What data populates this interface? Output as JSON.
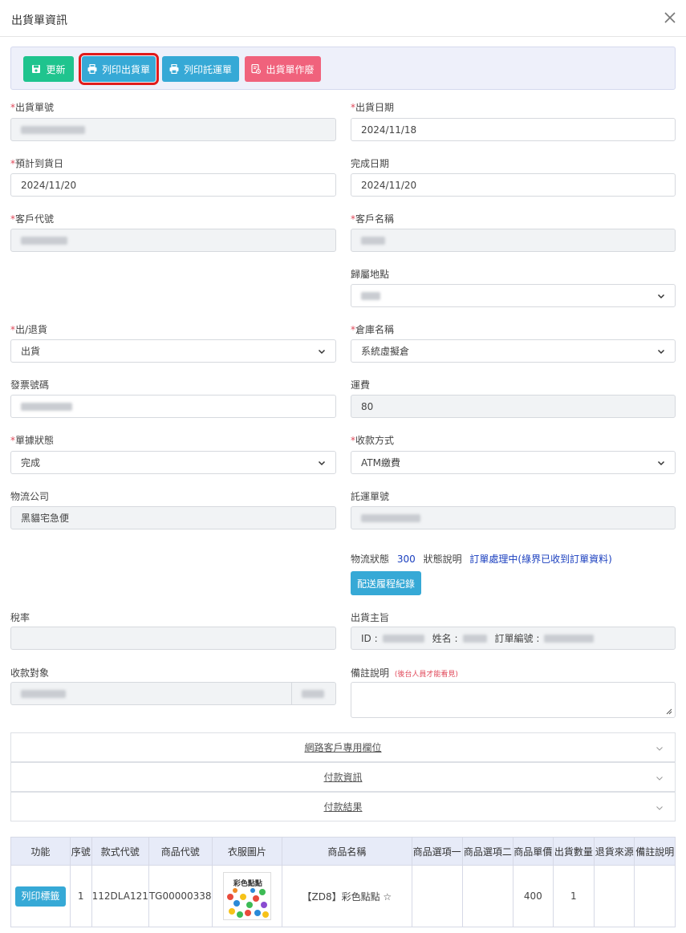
{
  "modal": {
    "title": "出貨單資訊"
  },
  "toolbar": {
    "update": "更新",
    "print_shipment": "列印出貨單",
    "print_consignment": "列印託運單",
    "void_shipment": "出貨單作廢"
  },
  "form": {
    "shipment_no": {
      "label": "出貨單號",
      "required": "*"
    },
    "shipment_date": {
      "label": "出貨日期",
      "required": "*",
      "value": "2024/11/18"
    },
    "expected_arrival": {
      "label": "預計到貨日",
      "required": "*",
      "value": "2024/11/20"
    },
    "completed_date": {
      "label": "完成日期",
      "value": "2024/11/20"
    },
    "customer_code": {
      "label": "客戶代號",
      "required": "*"
    },
    "customer_name": {
      "label": "客戶名稱",
      "required": "*"
    },
    "location": {
      "label": "歸屬地點"
    },
    "ship_return": {
      "label": "出/退貨",
      "required": "*",
      "value": "出貨"
    },
    "warehouse": {
      "label": "倉庫名稱",
      "required": "*",
      "value": "系統虛擬倉"
    },
    "invoice_no": {
      "label": "發票號碼"
    },
    "freight": {
      "label": "運費",
      "value": "80"
    },
    "doc_status": {
      "label": "單據狀態",
      "required": "*",
      "value": "完成"
    },
    "payment_method": {
      "label": "收款方式",
      "required": "*",
      "value": "ATM繳費"
    },
    "logistics_company": {
      "label": "物流公司",
      "value": "黑貓宅急便"
    },
    "consignment_no": {
      "label": "託運單號"
    },
    "logistics_status_label": "物流狀態",
    "logistics_status_code": "300",
    "status_desc_label": "狀態說明",
    "status_desc": "訂單處理中(綠界已收到訂單資料)",
    "delivery_log_button": "配送履程紀錄",
    "tax_rate": {
      "label": "稅率"
    },
    "shipment_subject": {
      "label": "出貨主旨",
      "id_prefix": "ID :",
      "name_prefix": "姓名 :",
      "order_prefix": "訂單編號 :"
    },
    "payee": {
      "label": "收款對象"
    },
    "remarks": {
      "label": "備註說明",
      "note": "(後台人員才能看見)"
    }
  },
  "accordions": [
    "網路客戶專用欄位",
    "付款資訊",
    "付款結果"
  ],
  "table": {
    "headers": [
      "功能",
      "序號",
      "款式代號",
      "商品代號",
      "衣服圖片",
      "商品名稱",
      "商品選項一",
      "商品選項二",
      "商品單價",
      "出貨數量",
      "退貨來源",
      "備註說明"
    ],
    "rows": [
      {
        "action": "列印標籤",
        "seq": "1",
        "style_code": "112DLA121",
        "product_code": "TG00000338",
        "image_caption": "彩色點點",
        "product_name": "【ZD8】彩色點點 ☆",
        "option1": "",
        "option2": "",
        "unit_price": "400",
        "qty": "1",
        "return_source": "",
        "remark": ""
      }
    ]
  }
}
